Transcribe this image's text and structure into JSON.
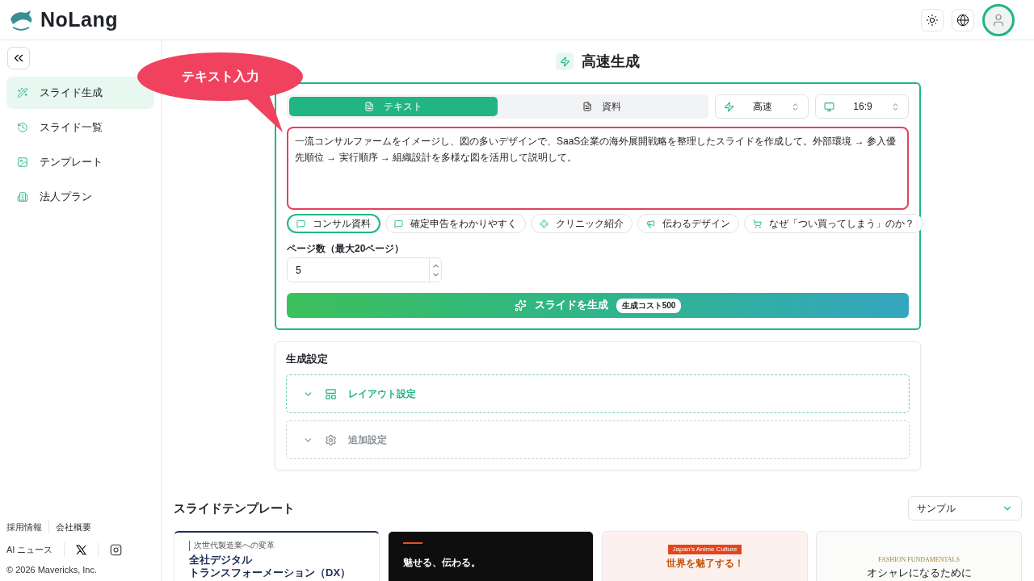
{
  "app": {
    "name": "NoLang"
  },
  "callout": {
    "text": "テキスト入力"
  },
  "sidebar": {
    "items": [
      {
        "label": "スライド生成",
        "selected": true
      },
      {
        "label": "スライド一覧",
        "selected": false
      },
      {
        "label": "テンプレート",
        "selected": false
      },
      {
        "label": "法人プラン",
        "selected": false
      }
    ],
    "footer_links": [
      "採用情報",
      "会社概要",
      "AI ニュース"
    ],
    "copyright": "© 2026 Mavericks, Inc."
  },
  "page_title": "高速生成",
  "source_tabs": [
    {
      "label": "テキスト",
      "selected": true
    },
    {
      "label": "資料",
      "selected": false
    }
  ],
  "selects": [
    {
      "value": "高速"
    },
    {
      "value": "16:9"
    }
  ],
  "prompt": {
    "value": "一流コンサルファームをイメージし、図の多いデザインで、SaaS企業の海外展開戦略を整理したスライドを作成して。外部環境 → 参入優先順位 → 実行順序 → 組織設計を多様な図を活用して説明して。"
  },
  "presets": [
    {
      "label": "コンサル資料",
      "selected": true
    },
    {
      "label": "確定申告をわかりやすく",
      "selected": false
    },
    {
      "label": "クリニック紹介",
      "selected": false
    },
    {
      "label": "伝わるデザイン",
      "selected": false
    },
    {
      "label": "なぜ「つい買ってしまう」のか？",
      "selected": false
    }
  ],
  "page_count": {
    "label": "ページ数（最大20ページ）",
    "value": "5"
  },
  "generate": {
    "label": "スライドを生成",
    "cost": "生成コスト500"
  },
  "settings": {
    "title": "生成設定",
    "sections": [
      {
        "label": "レイアウト設定",
        "expanded": false,
        "disabled": false
      },
      {
        "label": "追加設定",
        "expanded": false,
        "disabled": true
      }
    ]
  },
  "templates": {
    "title": "スライドテンプレート",
    "filter": "サンプル",
    "cards": [
      {
        "kind": "navy",
        "lines": [
          "次世代製造業への変革",
          "全社デジタル",
          "トランスフォーメーション（DX）"
        ]
      },
      {
        "kind": "dark",
        "lines": [
          "魅せる、伝わる。"
        ]
      },
      {
        "kind": "anime",
        "lines": [
          "Japan's Anime Culture",
          "世界を魅了する！"
        ]
      },
      {
        "kind": "fashion",
        "lines": [
          "FASHION FUNDAMENTALS",
          "オシャレになるために"
        ]
      }
    ]
  }
}
